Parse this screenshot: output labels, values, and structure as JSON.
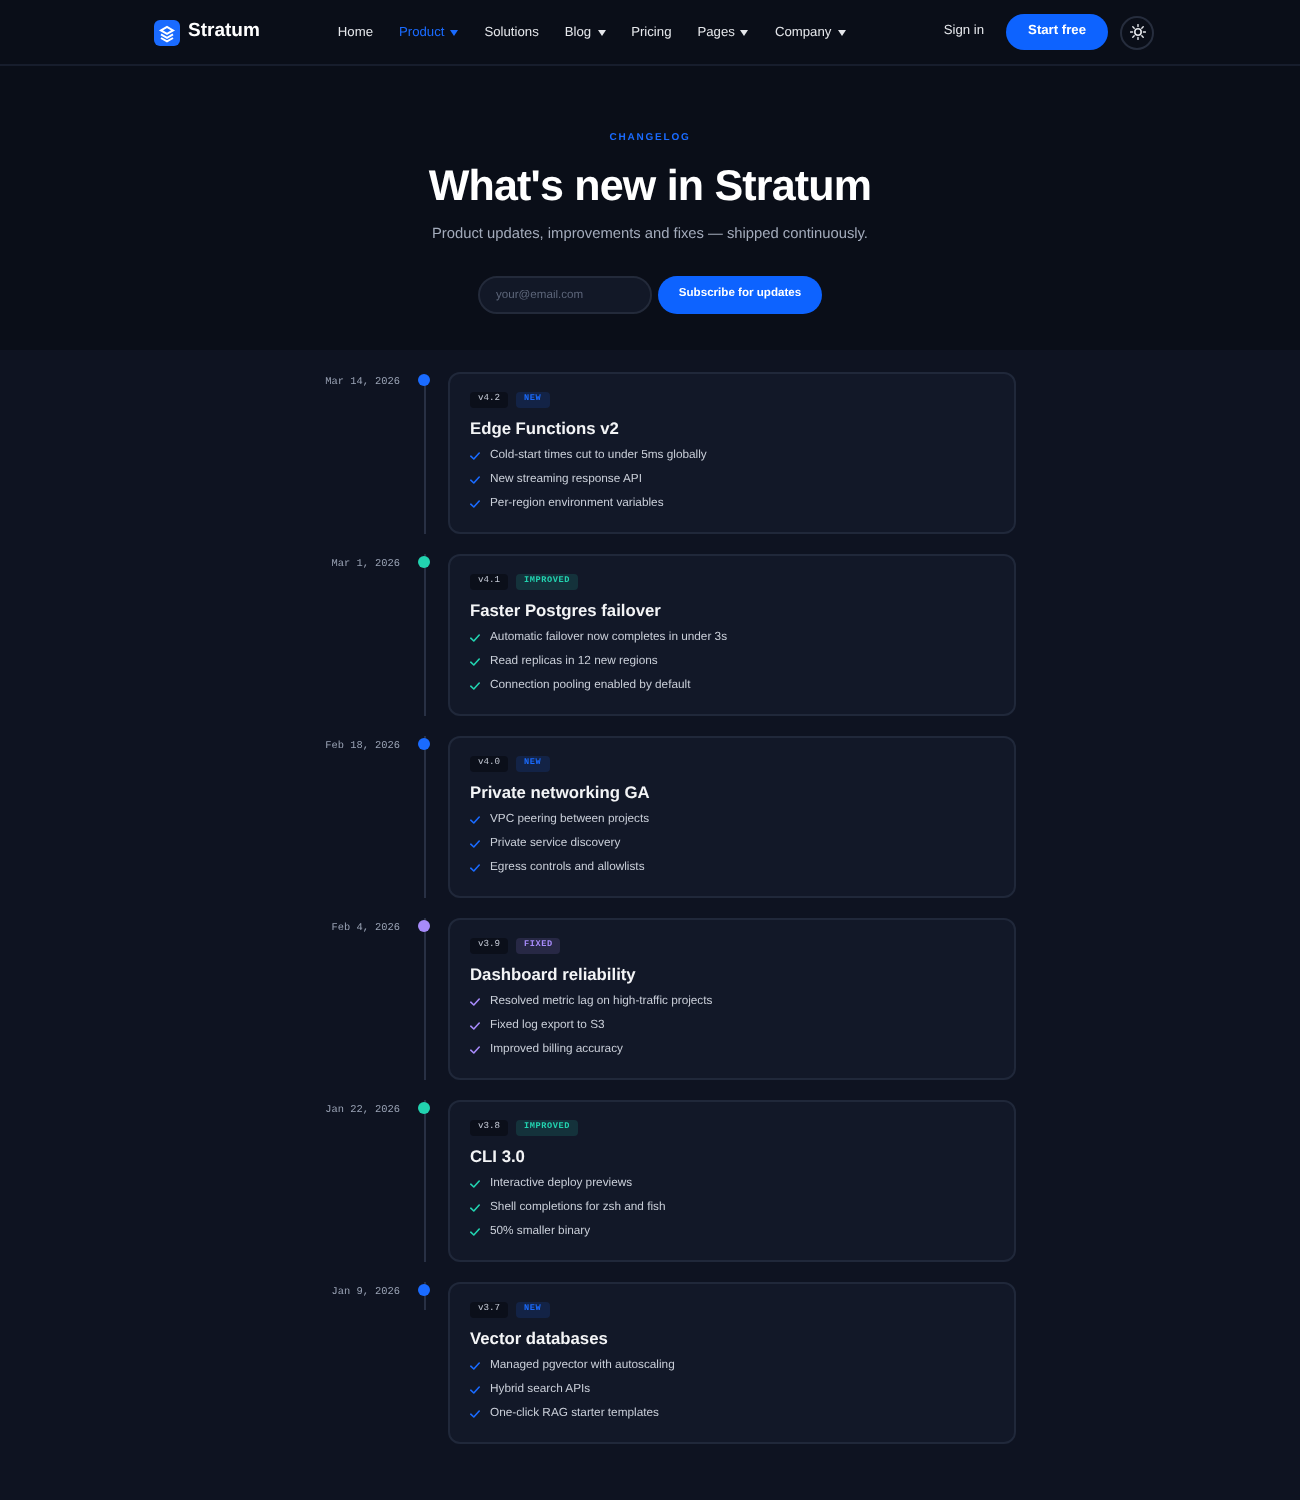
{
  "navbar": {
    "brand": "Stratum",
    "links": [
      {
        "label": "Home",
        "selected": false,
        "has_menu": false
      },
      {
        "label": "Product",
        "selected": true,
        "has_menu": true
      },
      {
        "label": "Solutions",
        "selected": false,
        "has_menu": false
      },
      {
        "label": "Blog",
        "selected": false,
        "has_menu": true
      },
      {
        "label": "Pricing",
        "selected": false,
        "has_menu": false
      },
      {
        "label": "Pages",
        "selected": false,
        "has_menu": true
      },
      {
        "label": "Company",
        "selected": false,
        "has_menu": true
      }
    ],
    "sign_in": "Sign in",
    "cta": "Start free"
  },
  "hero": {
    "eyebrow": "CHANGELOG",
    "title": "What's new in Stratum",
    "subtitle": "Product updates, improvements and fixes — shipped continuously.",
    "email": {
      "placeholder": "your@email.com"
    },
    "subscribe": "Subscribe for updates"
  },
  "entries": [
    {
      "date": "Mar 14, 2026",
      "version": "v4.2",
      "tag": "NEW",
      "color": "#1a6bff",
      "title": "Edge Functions v2",
      "items": [
        "Cold-start times cut to under 5ms globally",
        "New streaming response API",
        "Per-region environment variables"
      ]
    },
    {
      "date": "Mar 1, 2026",
      "version": "v4.1",
      "tag": "IMPROVED",
      "color": "#22d3b0",
      "title": "Faster Postgres failover",
      "items": [
        "Automatic failover now completes in under 3s",
        "Read replicas in 12 new regions",
        "Connection pooling enabled by default"
      ]
    },
    {
      "date": "Feb 18, 2026",
      "version": "v4.0",
      "tag": "NEW",
      "color": "#1a6bff",
      "title": "Private networking GA",
      "items": [
        "VPC peering between projects",
        "Private service discovery",
        "Egress controls and allowlists"
      ]
    },
    {
      "date": "Feb 4, 2026",
      "version": "v3.9",
      "tag": "FIXED",
      "color": "#a78bfa",
      "title": "Dashboard reliability",
      "items": [
        "Resolved metric lag on high-traffic projects",
        "Fixed log export to S3",
        "Improved billing accuracy"
      ]
    },
    {
      "date": "Jan 22, 2026",
      "version": "v3.8",
      "tag": "IMPROVED",
      "color": "#22d3b0",
      "title": "CLI 3.0",
      "items": [
        "Interactive deploy previews",
        "Shell completions for zsh and fish",
        "50% smaller binary"
      ]
    },
    {
      "date": "Jan 9, 2026",
      "version": "v3.7",
      "tag": "NEW",
      "color": "#1a6bff",
      "title": "Vector databases",
      "items": [
        "Managed pgvector with autoscaling",
        "Hybrid search APIs",
        "One-click RAG starter templates"
      ]
    }
  ]
}
